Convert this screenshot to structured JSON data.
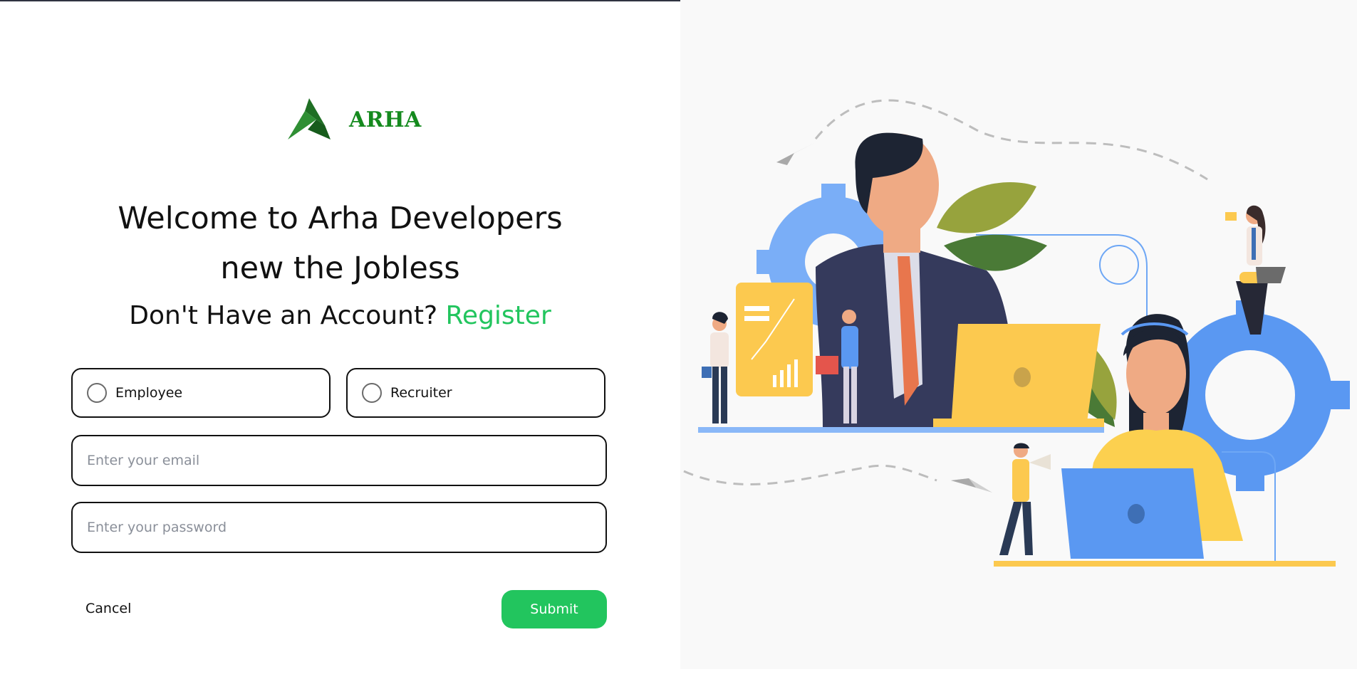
{
  "brand": {
    "name": "ARHA",
    "color": "#158a1e",
    "logo_icon": "arha-peak-logo-icon"
  },
  "heading": {
    "line1": "Welcome to Arha Developers",
    "line2": "new the Jobless"
  },
  "account_prompt": {
    "text": "Don't Have an Account?",
    "link": "Register",
    "link_color": "#22c55e"
  },
  "roles": [
    {
      "label": "Employee",
      "selected": false
    },
    {
      "label": "Recruiter",
      "selected": false
    }
  ],
  "form": {
    "email_placeholder": "Enter your email",
    "email_value": "",
    "password_placeholder": "Enter your password",
    "password_value": ""
  },
  "actions": {
    "cancel": "Cancel",
    "submit": "Submit",
    "submit_color": "#22c55e"
  },
  "illustration": {
    "icon": "office-team-illustration"
  }
}
